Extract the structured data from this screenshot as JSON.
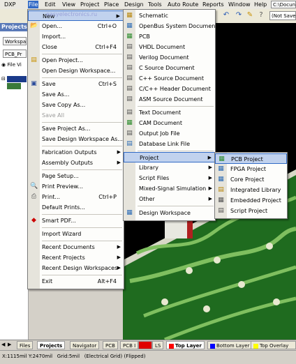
{
  "menubar": {
    "items": [
      "DXP",
      "File",
      "Edit",
      "View",
      "Project",
      "Place",
      "Design",
      "Tools",
      "Auto Route",
      "Reports",
      "Window",
      "Help"
    ],
    "path_label": "C:\\Docun"
  },
  "toolbar": {
    "not_saved_label": "(Not Save"
  },
  "watermark": "easyelectronics.ru",
  "panel": {
    "title": "Projects",
    "workspace_label": "Workspa",
    "project_label": "PCB_Pr",
    "radio_label": "File Vi"
  },
  "file_menu": [
    {
      "label": "New",
      "shortcut": "",
      "submenu": true,
      "icon": "blank-icon"
    },
    {
      "label": "Open...",
      "shortcut": "Ctrl+O",
      "icon": "open-folder-icon"
    },
    {
      "label": "Import...",
      "shortcut": ""
    },
    {
      "label": "Close",
      "shortcut": "Ctrl+F4"
    },
    {
      "label": "Open Project...",
      "shortcut": "",
      "icon": "open-project-icon"
    },
    {
      "label": "Open Design Workspace...",
      "shortcut": ""
    },
    {
      "label": "Save",
      "shortcut": "Ctrl+S",
      "icon": "save-icon"
    },
    {
      "label": "Save As...",
      "shortcut": ""
    },
    {
      "label": "Save Copy As...",
      "shortcut": ""
    },
    {
      "label": "Save All",
      "shortcut": "",
      "disabled": true
    },
    {
      "label": "Save Project As...",
      "shortcut": ""
    },
    {
      "label": "Save Design Workspace As...",
      "shortcut": ""
    },
    {
      "label": "Fabrication Outputs",
      "shortcut": "",
      "submenu": true
    },
    {
      "label": "Assembly Outputs",
      "shortcut": "",
      "submenu": true
    },
    {
      "label": "Page Setup...",
      "shortcut": ""
    },
    {
      "label": "Print Preview...",
      "shortcut": "",
      "icon": "print-preview-icon"
    },
    {
      "label": "Print...",
      "shortcut": "Ctrl+P",
      "icon": "print-icon"
    },
    {
      "label": "Default Prints...",
      "shortcut": ""
    },
    {
      "label": "Smart PDF...",
      "shortcut": "",
      "icon": "pdf-icon"
    },
    {
      "label": "Import Wizard",
      "shortcut": ""
    },
    {
      "label": "Recent Documents",
      "shortcut": "",
      "submenu": true
    },
    {
      "label": "Recent Projects",
      "shortcut": "",
      "submenu": true
    },
    {
      "label": "Recent Design Workspaces",
      "shortcut": "",
      "submenu": true
    },
    {
      "label": "Exit",
      "shortcut": "Alt+F4"
    }
  ],
  "new_menu": [
    {
      "label": "Schematic",
      "icon": "schematic-icon"
    },
    {
      "label": "OpenBus System Document",
      "icon": "openbus-icon"
    },
    {
      "label": "PCB",
      "icon": "pcb-icon"
    },
    {
      "label": "VHDL Document",
      "icon": "vhdl-icon"
    },
    {
      "label": "Verilog Document",
      "icon": "verilog-icon"
    },
    {
      "label": "C Source Document",
      "icon": "c-source-icon"
    },
    {
      "label": "C++ Source Document",
      "icon": "cpp-source-icon"
    },
    {
      "label": "C/C++ Header Document",
      "icon": "header-icon"
    },
    {
      "label": "ASM Source Document",
      "icon": "asm-icon"
    },
    {
      "label": "Text Document",
      "icon": "text-doc-icon"
    },
    {
      "label": "CAM Document",
      "icon": "cam-icon"
    },
    {
      "label": "Output Job File",
      "icon": "output-job-icon"
    },
    {
      "label": "Database Link File",
      "icon": "database-link-icon"
    },
    {
      "label": "Project",
      "submenu": true
    },
    {
      "label": "Library",
      "submenu": true
    },
    {
      "label": "Script Files",
      "submenu": true
    },
    {
      "label": "Mixed-Signal Simulation",
      "submenu": true
    },
    {
      "label": "Other",
      "submenu": true
    },
    {
      "label": "Design Workspace",
      "icon": "workspace-icon"
    }
  ],
  "project_menu": [
    {
      "label": "PCB Project",
      "icon": "pcb-project-icon"
    },
    {
      "label": "FPGA Project",
      "icon": "fpga-project-icon"
    },
    {
      "label": "Core Project",
      "icon": "core-project-icon"
    },
    {
      "label": "Integrated Library",
      "icon": "integrated-library-icon"
    },
    {
      "label": "Embedded Project",
      "icon": "embedded-project-icon"
    },
    {
      "label": "Script Project",
      "icon": "script-project-icon"
    }
  ],
  "bottom_tabs": {
    "files": "Files",
    "projects": "Projects",
    "navigator": "Navigator",
    "pcb": "PCB",
    "pcb2": "PCB I",
    "ls": "LS",
    "top_layer": "Top Layer",
    "bottom_layer": "Bottom Layer",
    "top_overlay": "Top Overlay"
  },
  "layer_colors": {
    "ls": "#e00000",
    "top_layer": "#ff0000",
    "bottom_layer": "#0000ff",
    "top_overlay": "#ffff00"
  },
  "status": "X:1115mil Y:2470mil   Grid:5mil   (Electrical Grid) (Flipped)",
  "colors": {
    "menu_highlight": "#c1d2ee",
    "menubar_active": "#3169c6",
    "pcb_board": "#1f6b1f"
  }
}
